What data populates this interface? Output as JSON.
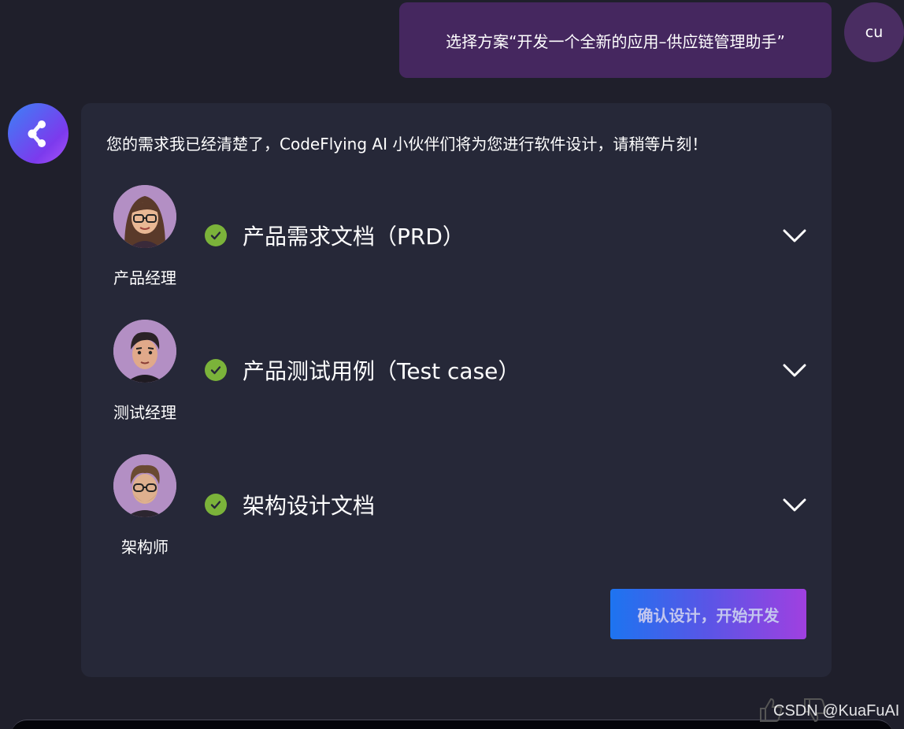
{
  "user": {
    "message": "选择方案“开发一个全新的应用–供应链管理助手”",
    "avatar_text": "cu"
  },
  "bot": {
    "avatar_icon": "share-logo-icon",
    "intro": "您的需求我已经清楚了，CodeFlying AI 小伙伴们将为您进行软件设计，请稍等片刻！",
    "rows": [
      {
        "role": "产品经理",
        "doc": "产品需求文档（PRD）",
        "status": "done",
        "avatar_icon": "female-avatar-icon"
      },
      {
        "role": "测试经理",
        "doc": "产品测试用例（Test case）",
        "status": "done",
        "avatar_icon": "male-avatar-icon"
      },
      {
        "role": "架构师",
        "doc": "架构设计文档",
        "status": "done",
        "avatar_icon": "bearded-avatar-icon"
      }
    ],
    "confirm_label": "确认设计，开始开发"
  },
  "watermark": "CSDN @KuaFuAI",
  "colors": {
    "background": "#1f1f2b",
    "card": "#262838",
    "user_bubble": "#45275f",
    "check": "#7bb33a",
    "button_gradient_start": "#1d74f0",
    "button_gradient_end": "#a040e0"
  }
}
